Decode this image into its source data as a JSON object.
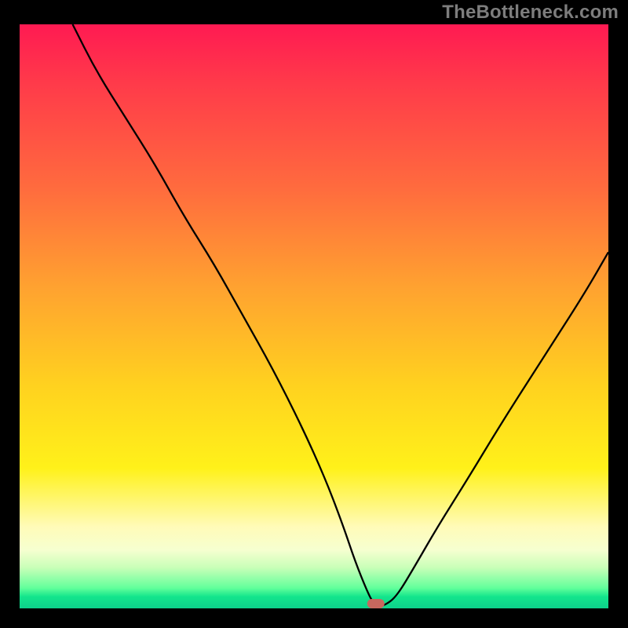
{
  "watermark": "TheBottleneck.com",
  "colors": {
    "gradient_top": "#ff1a52",
    "gradient_mid1": "#ff6b3e",
    "gradient_mid2": "#ffd21f",
    "gradient_mid3": "#fffbb8",
    "gradient_bottom": "#0dd18b",
    "curve": "#000000",
    "marker": "#c8675e",
    "frame": "#000000"
  },
  "chart_data": {
    "type": "line",
    "title": "",
    "xlabel": "",
    "ylabel": "",
    "xlim": [
      0,
      100
    ],
    "ylim": [
      0,
      100
    ],
    "grid": false,
    "legend": false,
    "description": "V-shaped bottleneck curve. Falls steeply from top-left toward a minimum near x≈60 at y≈0, then rises toward the right edge reaching roughly y≈60. A small rounded marker sits at the trough.",
    "x": [
      9,
      13,
      18,
      23,
      28,
      33,
      38,
      43,
      48,
      52,
      55,
      57,
      59,
      60,
      61,
      62,
      64,
      67,
      71,
      76,
      82,
      89,
      96,
      100
    ],
    "values": [
      100,
      92,
      84,
      76,
      67,
      59,
      50,
      41,
      31,
      22,
      14,
      8,
      3,
      1,
      0.5,
      0.5,
      2,
      7,
      14,
      22,
      32,
      43,
      54,
      61
    ],
    "marker": {
      "x": 60.5,
      "y": 0.8
    }
  }
}
